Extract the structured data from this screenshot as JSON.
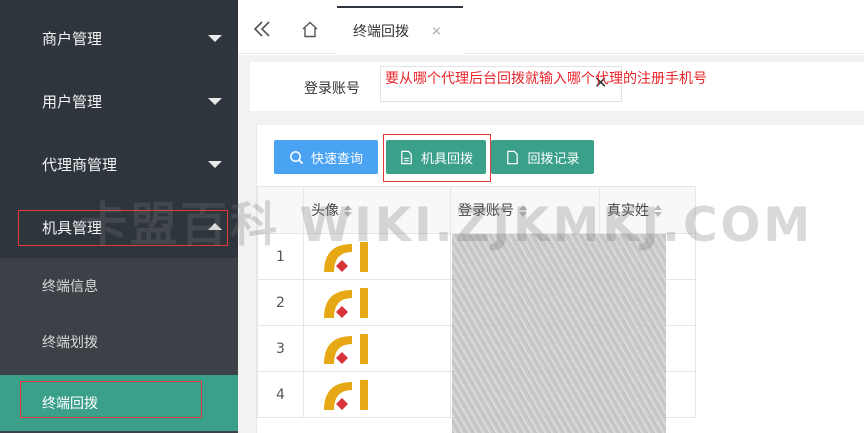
{
  "sidebar": {
    "items": [
      {
        "label": "商户管理"
      },
      {
        "label": "用户管理"
      },
      {
        "label": "代理商管理"
      },
      {
        "label": "机具管理"
      }
    ],
    "sub_items": [
      {
        "label": "终端信息"
      },
      {
        "label": "终端划拨"
      },
      {
        "label": "终端回拨"
      }
    ]
  },
  "tabbar": {
    "back_icon": "double-chevron-left-icon",
    "home_icon": "home-icon",
    "active_tab": "终端回拨",
    "close_symbol": "×"
  },
  "search": {
    "label": "登录账号",
    "placeholder": "",
    "clear_symbol": "✕",
    "annotation": "要从哪个代理后台回拨就输入哪个代理的注册手机号"
  },
  "toolbar": {
    "query_label": "快速查询",
    "recall_label": "机具回拨",
    "records_label": "回拨记录"
  },
  "table": {
    "columns": [
      "头像",
      "登录账号",
      "真实姓"
    ],
    "rows": [
      {
        "num": "1"
      },
      {
        "num": "2"
      },
      {
        "num": "3"
      },
      {
        "num": "4"
      }
    ]
  },
  "watermark": "卡盟百科 WIKI.ZJKMKJ.COM",
  "colors": {
    "sidebar_bg": "#2f353d",
    "active_green": "#3aa08a",
    "query_blue": "#4aa2f3",
    "annotation_red": "#e8252a"
  }
}
